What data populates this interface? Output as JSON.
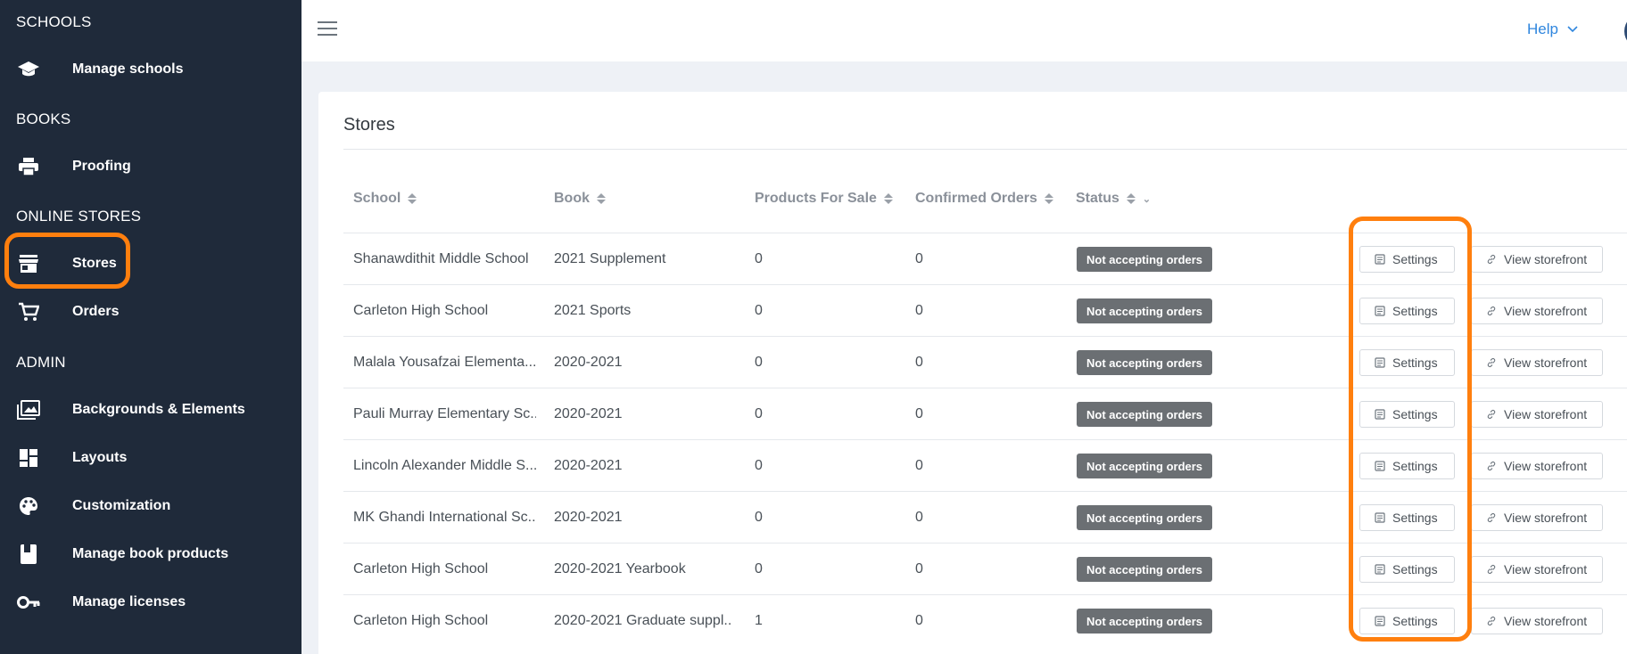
{
  "sidebar": {
    "sections": [
      {
        "title": "SCHOOLS"
      },
      {
        "title": "BOOKS"
      },
      {
        "title": "ONLINE STORES"
      },
      {
        "title": "ADMIN"
      }
    ],
    "items": [
      {
        "label": "Manage schools",
        "icon": "graduation-cap-icon"
      },
      {
        "label": "Proofing",
        "icon": "printer-icon"
      },
      {
        "label": "Stores",
        "icon": "store-icon"
      },
      {
        "label": "Orders",
        "icon": "cart-icon"
      },
      {
        "label": "Backgrounds & Elements",
        "icon": "images-icon"
      },
      {
        "label": "Layouts",
        "icon": "layouts-icon"
      },
      {
        "label": "Customization",
        "icon": "palette-icon"
      },
      {
        "label": "Manage book products",
        "icon": "book-icon"
      },
      {
        "label": "Manage licenses",
        "icon": "key-icon"
      }
    ]
  },
  "topbar": {
    "help_label": "Help"
  },
  "card": {
    "title": "Stores"
  },
  "table": {
    "headers": {
      "school": "School",
      "book": "Book",
      "products": "Products For Sale",
      "orders": "Confirmed Orders",
      "status": "Status"
    },
    "rows": [
      {
        "school": "Shanawdithit Middle School",
        "book": "2021 Supplement",
        "products": "0",
        "orders": "0",
        "status": "Not accepting orders"
      },
      {
        "school": "Carleton High School",
        "book": "2021 Sports",
        "products": "0",
        "orders": "0",
        "status": "Not accepting orders"
      },
      {
        "school": "Malala Yousafzai Elementa...",
        "book": "2020-2021",
        "products": "0",
        "orders": "0",
        "status": "Not accepting orders"
      },
      {
        "school": "Pauli Murray Elementary Sc...",
        "book": "2020-2021",
        "products": "0",
        "orders": "0",
        "status": "Not accepting orders"
      },
      {
        "school": "Lincoln Alexander Middle S...",
        "book": "2020-2021",
        "products": "0",
        "orders": "0",
        "status": "Not accepting orders"
      },
      {
        "school": "MK Ghandi International Sc...",
        "book": "2020-2021",
        "products": "0",
        "orders": "0",
        "status": "Not accepting orders"
      },
      {
        "school": "Carleton High School",
        "book": "2020-2021 Yearbook",
        "products": "0",
        "orders": "0",
        "status": "Not accepting orders"
      },
      {
        "school": "Carleton High School",
        "book": "2020-2021 Graduate suppl...",
        "products": "1",
        "orders": "0",
        "status": "Not accepting orders"
      }
    ],
    "settings_label": "Settings",
    "view_label": "View storefront"
  },
  "colors": {
    "sidebar_bg": "#1f2a3a",
    "highlight": "#ff7f0e",
    "link": "#2f86de",
    "badge": "#6b6f73"
  }
}
